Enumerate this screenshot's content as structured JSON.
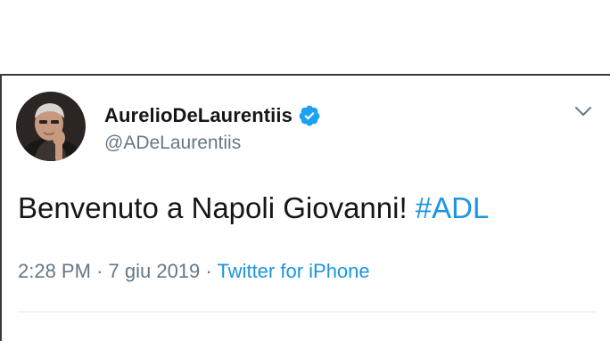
{
  "user": {
    "display_name": "AurelioDeLaurentiis",
    "handle": "@ADeLaurentiis",
    "verified": true,
    "avatar_icon": "profile-photo"
  },
  "tweet": {
    "text": "Benvenuto a Napoli Giovanni! ",
    "hashtag": "#ADL",
    "time": "2:28 PM",
    "separator": "·",
    "date": "7 giu 2019",
    "source": "Twitter for iPhone"
  },
  "icons": {
    "verified": "verified-badge-icon",
    "menu": "chevron-down-icon"
  },
  "colors": {
    "link": "#1b95e0",
    "secondary_text": "#657786",
    "primary_text": "#14171a",
    "verified_badge": "#1da1f2"
  }
}
